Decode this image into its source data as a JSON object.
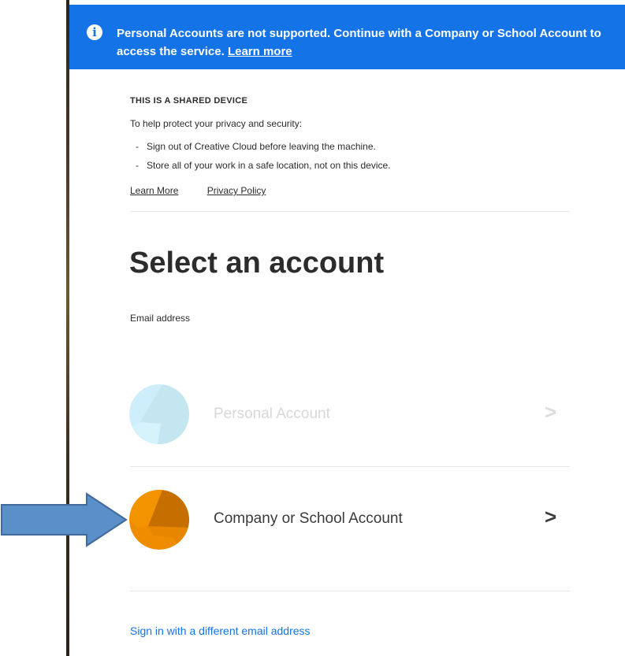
{
  "banner": {
    "icon": "info-icon",
    "message": "Personal Accounts are not supported. Continue with a Company or School Account to access the service.",
    "learn_more": "Learn more"
  },
  "shared_device": {
    "title": "THIS IS A SHARED DEVICE",
    "description": "To help protect your privacy and security:",
    "bullets": [
      "Sign out of Creative Cloud before leaving the machine.",
      "Store all of your work in a safe location, not on this device."
    ],
    "learn_more": "Learn More",
    "privacy_policy": "Privacy Policy"
  },
  "main": {
    "title": "Select an account",
    "email_label": "Email address"
  },
  "accounts": [
    {
      "label": "Personal Account",
      "state": "disabled",
      "color": "#cdeefa"
    },
    {
      "label": "Company or School Account",
      "state": "enabled",
      "color": "#f08c00"
    }
  ],
  "chevron_glyph": ">",
  "bullet_glyph": "-",
  "footer": {
    "sign_in_different": "Sign in with a different email address"
  },
  "colors": {
    "accent": "#1473e6",
    "arrow_fill": "#5b8fc9",
    "arrow_stroke": "#3f6a9a"
  }
}
